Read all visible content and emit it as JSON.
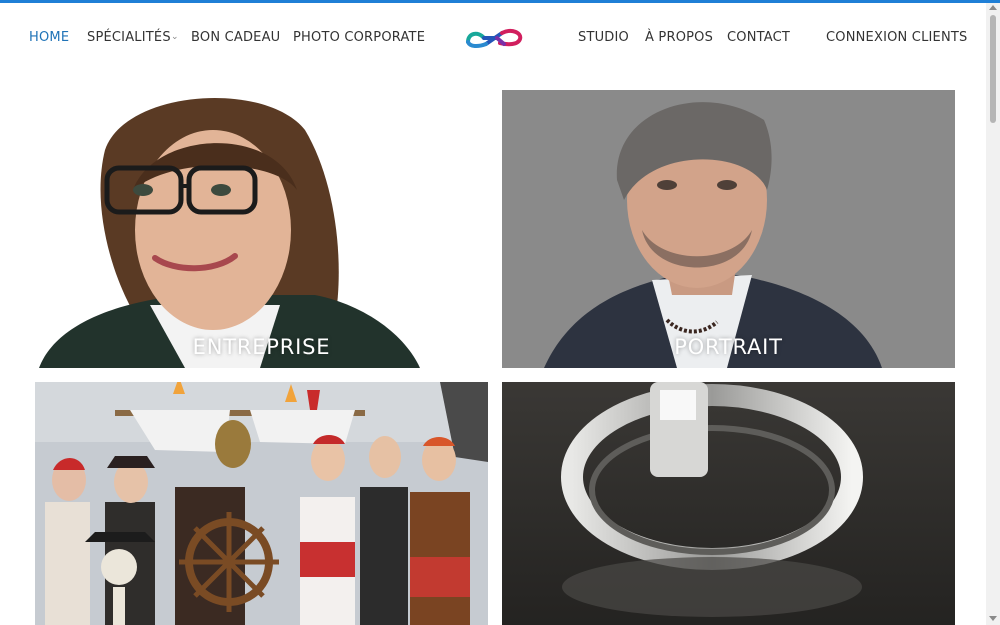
{
  "accent_color": "#1f7fd6",
  "active_link_color": "#1f73b7",
  "nav": {
    "home": "Home",
    "specialites": "Spécialités",
    "bon_cadeau": "Bon Cadeau",
    "photo_corporate": "Photo Corporate",
    "studio": "Studio",
    "a_propos": "À propos",
    "contact": "Contact",
    "connexion": "Connexion clients",
    "dropdown_icon": "chevron-down-icon"
  },
  "logo": {
    "icon": "infinity-logo-icon",
    "colors": [
      "#18a89a",
      "#2356b8",
      "#d11f5e"
    ]
  },
  "tiles": [
    {
      "label": "ENTREPRISE",
      "image": "woman-business-portrait"
    },
    {
      "label": "PORTRAIT",
      "image": "man-portrait-grey-background"
    },
    {
      "label": "",
      "image": "pirate-party-group-photo"
    },
    {
      "label": "",
      "image": "silver-ring-closeup"
    }
  ]
}
